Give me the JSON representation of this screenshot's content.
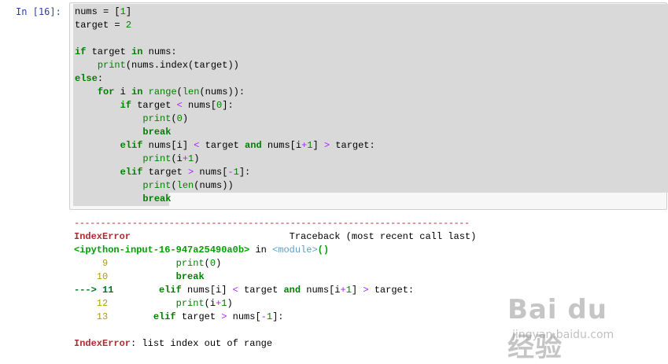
{
  "cell": {
    "prompt": "In  [16]:",
    "code_lines": [
      "nums = [1]",
      "target = 2",
      "",
      "if target in nums:",
      "    print(nums.index(target))",
      "else:",
      "    for i in range(len(nums)):",
      "        if target < nums[0]:",
      "            print(0)",
      "            break",
      "        elif nums[i] < target and nums[i+1] > target:",
      "            print(i+1)",
      "        elif target > nums[-1]:",
      "            print(len(nums))",
      "            break"
    ]
  },
  "output": {
    "separator": "---------------------------------------------------------------------------",
    "error_name": "IndexError",
    "traceback_label": "Traceback (most recent call last)",
    "input_ref": "<ipython-input-16-947a25490a0b>",
    "in_word": " in ",
    "module_ref": "<module>",
    "module_parens": "()",
    "trace_lines": [
      {
        "marker": "     ",
        "num": "9",
        "code": "            print(0)"
      },
      {
        "marker": "     ",
        "num": "10",
        "code": "            break"
      },
      {
        "marker": "---> ",
        "num": "11",
        "code": "        elif nums[i] < target and nums[i+1] > target:"
      },
      {
        "marker": "     ",
        "num": "12",
        "code": "            print(i+1)"
      },
      {
        "marker": "     ",
        "num": "13",
        "code": "        elif target > nums[-1]:"
      }
    ],
    "final_error_name": "IndexError",
    "final_error_msg": ": list index out of range"
  },
  "watermark": {
    "logo": "Bai du 经验",
    "url": "jingyan.baidu.com"
  }
}
